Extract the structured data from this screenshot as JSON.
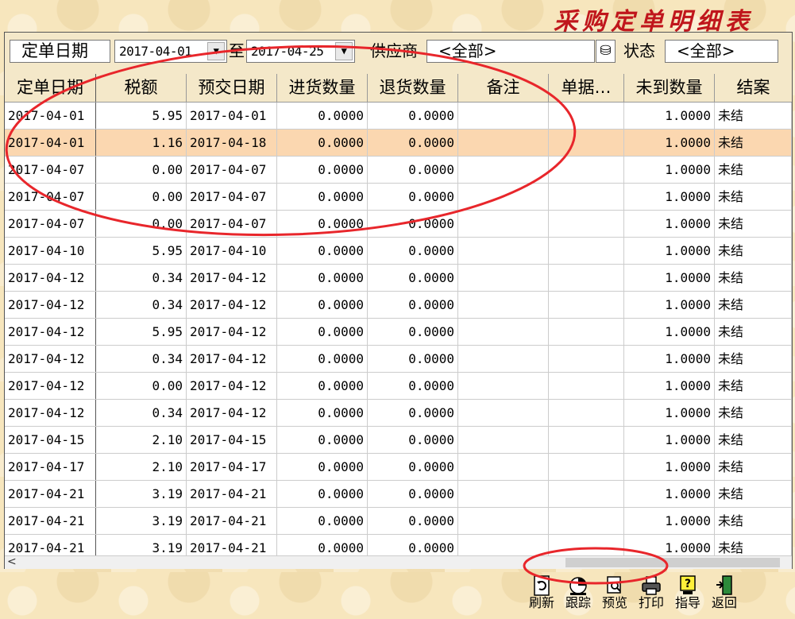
{
  "window_title": "采购定单明细表",
  "filter": {
    "date_label": "定单日期",
    "date_from": "2017-04-01",
    "to_label": "至",
    "date_to": "2017-04-25",
    "supplier_label": "供应商",
    "supplier_value": "<全部>",
    "status_label": "状态",
    "status_value": "<全部>"
  },
  "columns": [
    "定单日期",
    "税额",
    "预交日期",
    "进货数量",
    "退货数量",
    "备注",
    "单据…",
    "未到数量",
    "结案"
  ],
  "rows": [
    {
      "date": "2017-04-01",
      "tax": "5.95",
      "due": "2017-04-01",
      "in_qty": "0.0000",
      "ret_qty": "0.0000",
      "note": "",
      "doc": "",
      "pending": "1.0000",
      "closed": "未结"
    },
    {
      "date": "2017-04-01",
      "tax": "1.16",
      "due": "2017-04-18",
      "in_qty": "0.0000",
      "ret_qty": "0.0000",
      "note": "",
      "doc": "",
      "pending": "1.0000",
      "closed": "未结"
    },
    {
      "date": "2017-04-07",
      "tax": "0.00",
      "due": "2017-04-07",
      "in_qty": "0.0000",
      "ret_qty": "0.0000",
      "note": "",
      "doc": "",
      "pending": "1.0000",
      "closed": "未结"
    },
    {
      "date": "2017-04-07",
      "tax": "0.00",
      "due": "2017-04-07",
      "in_qty": "0.0000",
      "ret_qty": "0.0000",
      "note": "",
      "doc": "",
      "pending": "1.0000",
      "closed": "未结"
    },
    {
      "date": "2017-04-07",
      "tax": "0.00",
      "due": "2017-04-07",
      "in_qty": "0.0000",
      "ret_qty": "0.0000",
      "note": "",
      "doc": "",
      "pending": "1.0000",
      "closed": "未结"
    },
    {
      "date": "2017-04-10",
      "tax": "5.95",
      "due": "2017-04-10",
      "in_qty": "0.0000",
      "ret_qty": "0.0000",
      "note": "",
      "doc": "",
      "pending": "1.0000",
      "closed": "未结"
    },
    {
      "date": "2017-04-12",
      "tax": "0.34",
      "due": "2017-04-12",
      "in_qty": "0.0000",
      "ret_qty": "0.0000",
      "note": "",
      "doc": "",
      "pending": "1.0000",
      "closed": "未结"
    },
    {
      "date": "2017-04-12",
      "tax": "0.34",
      "due": "2017-04-12",
      "in_qty": "0.0000",
      "ret_qty": "0.0000",
      "note": "",
      "doc": "",
      "pending": "1.0000",
      "closed": "未结"
    },
    {
      "date": "2017-04-12",
      "tax": "5.95",
      "due": "2017-04-12",
      "in_qty": "0.0000",
      "ret_qty": "0.0000",
      "note": "",
      "doc": "",
      "pending": "1.0000",
      "closed": "未结"
    },
    {
      "date": "2017-04-12",
      "tax": "0.34",
      "due": "2017-04-12",
      "in_qty": "0.0000",
      "ret_qty": "0.0000",
      "note": "",
      "doc": "",
      "pending": "1.0000",
      "closed": "未结"
    },
    {
      "date": "2017-04-12",
      "tax": "0.00",
      "due": "2017-04-12",
      "in_qty": "0.0000",
      "ret_qty": "0.0000",
      "note": "",
      "doc": "",
      "pending": "1.0000",
      "closed": "未结"
    },
    {
      "date": "2017-04-12",
      "tax": "0.34",
      "due": "2017-04-12",
      "in_qty": "0.0000",
      "ret_qty": "0.0000",
      "note": "",
      "doc": "",
      "pending": "1.0000",
      "closed": "未结"
    },
    {
      "date": "2017-04-15",
      "tax": "2.10",
      "due": "2017-04-15",
      "in_qty": "0.0000",
      "ret_qty": "0.0000",
      "note": "",
      "doc": "",
      "pending": "1.0000",
      "closed": "未结"
    },
    {
      "date": "2017-04-17",
      "tax": "2.10",
      "due": "2017-04-17",
      "in_qty": "0.0000",
      "ret_qty": "0.0000",
      "note": "",
      "doc": "",
      "pending": "1.0000",
      "closed": "未结"
    },
    {
      "date": "2017-04-21",
      "tax": "3.19",
      "due": "2017-04-21",
      "in_qty": "0.0000",
      "ret_qty": "0.0000",
      "note": "",
      "doc": "",
      "pending": "1.0000",
      "closed": "未结"
    },
    {
      "date": "2017-04-21",
      "tax": "3.19",
      "due": "2017-04-21",
      "in_qty": "0.0000",
      "ret_qty": "0.0000",
      "note": "",
      "doc": "",
      "pending": "1.0000",
      "closed": "未结"
    },
    {
      "date": "2017-04-21",
      "tax": "3.19",
      "due": "2017-04-21",
      "in_qty": "0.0000",
      "ret_qty": "0.0000",
      "note": "",
      "doc": "",
      "pending": "1.0000",
      "closed": "未结"
    }
  ],
  "selected_row": 1,
  "scrollbar_arrow": "<",
  "toolbar": [
    {
      "label": "刷新",
      "icon": "refresh-icon"
    },
    {
      "label": "跟踪",
      "icon": "pie-chart-icon"
    },
    {
      "label": "预览",
      "icon": "preview-icon"
    },
    {
      "label": "打印",
      "icon": "printer-icon"
    },
    {
      "label": "指导",
      "icon": "help-icon"
    },
    {
      "label": "返回",
      "icon": "exit-icon"
    }
  ],
  "colors": {
    "title": "#c0161c",
    "selected_row": "#fbd7b0",
    "annotation": "#e8262b"
  }
}
